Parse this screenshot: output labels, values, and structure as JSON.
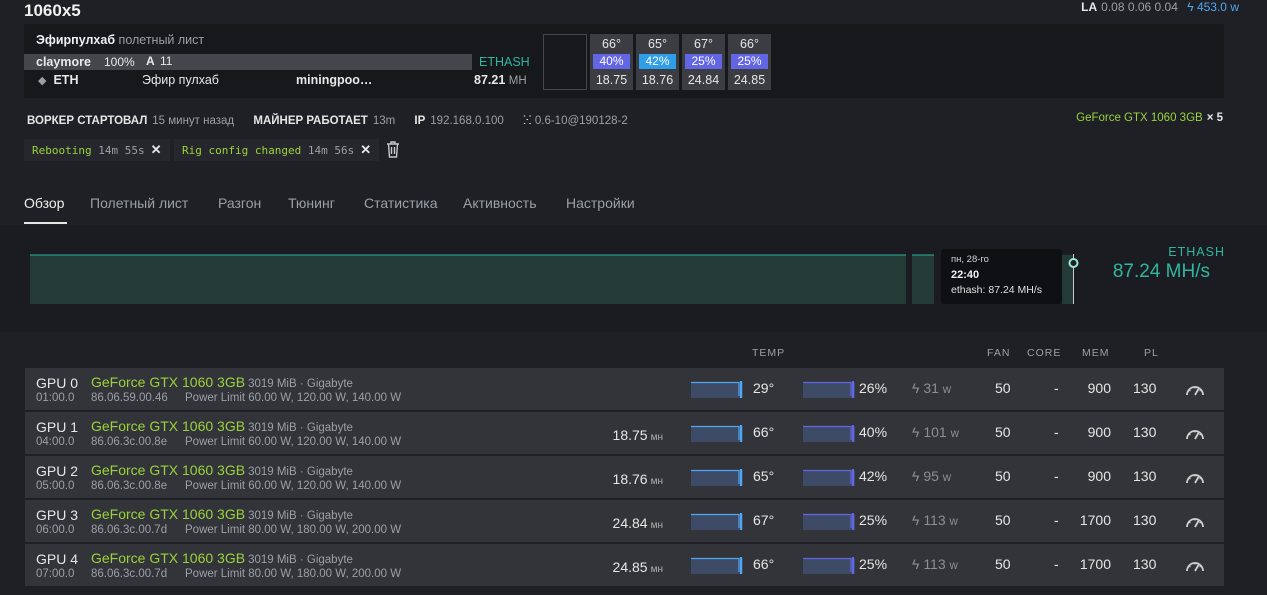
{
  "rig": {
    "name": "1060x5",
    "la_label": "LA",
    "la_values": "0.08 0.06 0.04",
    "power": "453.0",
    "power_unit": "w"
  },
  "flightsheet": {
    "farm": "Эфирпулхаб",
    "label": "полетный лист",
    "miner": "claymore",
    "miner_percent": "100%",
    "accepted_label": "A",
    "accepted": "11",
    "algo": "ETHASH",
    "coin": "ETH",
    "pool_name": "Эфир пулхаб",
    "pool_host": "miningpoo…",
    "hashrate": "87.21",
    "hashrate_unit": "MH"
  },
  "gpu_summary": [
    {
      "temp": "66°",
      "fan": "40%",
      "hash": "18.75"
    },
    {
      "temp": "65°",
      "fan": "42%",
      "hash": "18.76"
    },
    {
      "temp": "67°",
      "fan": "25%",
      "hash": "24.84"
    },
    {
      "temp": "66°",
      "fan": "25%",
      "hash": "24.85"
    }
  ],
  "info": {
    "worker_label": "ВОРКЕР СТАРТОВАЛ",
    "worker_value": "15 минут назад",
    "miner_label": "МАЙНЕР РАБОТАЕТ",
    "miner_value": "13m",
    "ip_label": "IP",
    "ip_value": "192.168.0.100",
    "version": "0.6-10@190128-2",
    "gpu_model": "GeForce GTX 1060 3GB",
    "gpu_count": "× 5"
  },
  "tags": [
    {
      "text": "Rebooting",
      "time": "14m 55s"
    },
    {
      "text": "Rig config changed",
      "time": "14m 56s"
    }
  ],
  "tabs": [
    "Обзор",
    "Полетный лист",
    "Разгон",
    "Тюнинг",
    "Статистика",
    "Активность",
    "Настройки"
  ],
  "tooltip": {
    "date": "пн, 28-го",
    "time": "22:40",
    "value": "ethash: 87.24 MH/s"
  },
  "chart_data": {
    "type": "area",
    "series": [
      {
        "name": "ethash",
        "values": [
          87.2,
          87.2,
          87.2,
          87.2,
          87.2,
          87.2,
          87.2,
          87.2,
          87.24
        ]
      }
    ],
    "current_algo": "ETHASH",
    "current_value": "87.24 MH/s"
  },
  "table": {
    "headers": {
      "temp": "TEMP",
      "fan": "FAN",
      "core": "CORE",
      "mem": "MEM",
      "pl": "PL"
    },
    "hash_unit": "мн",
    "power_unit": "w",
    "rows": [
      {
        "id": "GPU 0",
        "bus": "01:00.0",
        "name": "GeForce GTX 1060 3GB",
        "meta": "3019 MiB · Gigabyte",
        "bios": "86.06.59.00.46",
        "plimit": "Power Limit 60.00 W, 120.00 W, 140.00 W",
        "hash": "",
        "temp": "29°",
        "fanp": "26%",
        "power": "31",
        "fan": "50",
        "core": "-",
        "mem": "900",
        "pl": "130"
      },
      {
        "id": "GPU 1",
        "bus": "04:00.0",
        "name": "GeForce GTX 1060 3GB",
        "meta": "3019 MiB · Gigabyte",
        "bios": "86.06.3c.00.8e",
        "plimit": "Power Limit 60.00 W, 120.00 W, 140.00 W",
        "hash": "18.75",
        "temp": "66°",
        "fanp": "40%",
        "power": "101",
        "fan": "50",
        "core": "-",
        "mem": "900",
        "pl": "130"
      },
      {
        "id": "GPU 2",
        "bus": "05:00.0",
        "name": "GeForce GTX 1060 3GB",
        "meta": "3019 MiB · Gigabyte",
        "bios": "86.06.3c.00.8e",
        "plimit": "Power Limit 60.00 W, 120.00 W, 140.00 W",
        "hash": "18.76",
        "temp": "65°",
        "fanp": "42%",
        "power": "95",
        "fan": "50",
        "core": "-",
        "mem": "900",
        "pl": "130"
      },
      {
        "id": "GPU 3",
        "bus": "06:00.0",
        "name": "GeForce GTX 1060 3GB",
        "meta": "3019 MiB · Gigabyte",
        "bios": "86.06.3c.00.7d",
        "plimit": "Power Limit 80.00 W, 180.00 W, 200.00 W",
        "hash": "24.84",
        "temp": "67°",
        "fanp": "25%",
        "power": "113",
        "fan": "50",
        "core": "-",
        "mem": "1700",
        "pl": "130"
      },
      {
        "id": "GPU 4",
        "bus": "07:00.0",
        "name": "GeForce GTX 1060 3GB",
        "meta": "3019 MiB · Gigabyte",
        "bios": "86.06.3c.00.7d",
        "plimit": "Power Limit 80.00 W, 180.00 W, 200.00 W",
        "hash": "24.85",
        "temp": "66°",
        "fanp": "25%",
        "power": "113",
        "fan": "50",
        "core": "-",
        "mem": "1700",
        "pl": "130"
      }
    ]
  }
}
